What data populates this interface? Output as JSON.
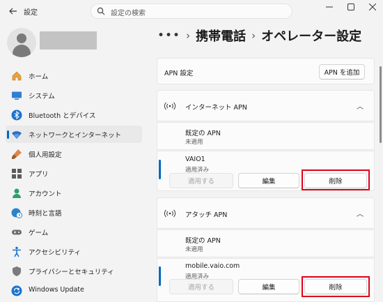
{
  "app": {
    "title": "設定"
  },
  "search": {
    "placeholder": "設定の検索"
  },
  "sidebar": {
    "items": [
      {
        "label": "ホーム"
      },
      {
        "label": "システム"
      },
      {
        "label": "Bluetooth とデバイス"
      },
      {
        "label": "ネットワークとインターネット"
      },
      {
        "label": "個人用設定"
      },
      {
        "label": "アプリ"
      },
      {
        "label": "アカウント"
      },
      {
        "label": "時刻と言語"
      },
      {
        "label": "ゲーム"
      },
      {
        "label": "アクセシビリティ"
      },
      {
        "label": "プライバシーとセキュリティ"
      },
      {
        "label": "Windows Update"
      }
    ]
  },
  "breadcrumb": {
    "more": "•••",
    "items": [
      "携帯電話",
      "オペレーター設定"
    ]
  },
  "apn_settings": {
    "label": "APN 設定",
    "add_button": "APN を追加"
  },
  "sections": [
    {
      "title": "インターネット APN",
      "default_label": "既定の APN",
      "default_status": "未適用",
      "entry_name": "VAIO1",
      "entry_status": "適用済み",
      "apply_button": "適用する",
      "edit_button": "編集",
      "delete_button": "削除"
    },
    {
      "title": "アタッチ APN",
      "default_label": "既定の APN",
      "default_status": "未適用",
      "entry_name": "mobile.vaio.com",
      "entry_status": "適用済み",
      "apply_button": "適用する",
      "edit_button": "編集",
      "delete_button": "削除"
    }
  ],
  "colors": {
    "accent": "#0067c0",
    "highlight": "#e0001b"
  }
}
